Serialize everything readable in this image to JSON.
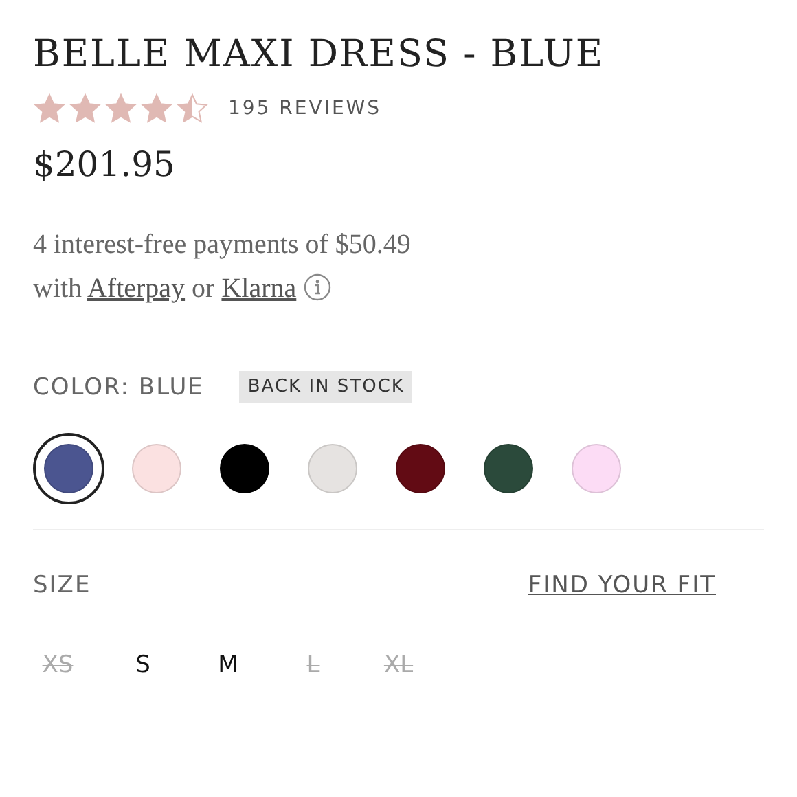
{
  "product": {
    "title": "BELLE MAXI DRESS - BLUE",
    "stars": 4.5,
    "reviews": "195 REVIEWS",
    "price": "$201.95"
  },
  "payment": {
    "lead": "4 interest-free payments of $50.49 with",
    "provider_1": "Afterpay",
    "separator": "or",
    "provider_2": "Klarna"
  },
  "color": {
    "label": "COLOR: BLUE",
    "badge": "BACK IN STOCK",
    "swatches": [
      {
        "color": "#4b5590",
        "selected": true
      },
      {
        "color": "#fbe1e1",
        "selected": false
      },
      {
        "color": "#000000",
        "selected": false
      },
      {
        "color": "#e6e3e1",
        "selected": false
      },
      {
        "color": "#620b14",
        "selected": false
      },
      {
        "color": "#2b4a3b",
        "selected": false
      },
      {
        "color": "#fcdcf5",
        "selected": false
      }
    ]
  },
  "size": {
    "label": "SIZE",
    "fit_link": "FIND YOUR FIT",
    "options": [
      {
        "label": "XS",
        "disabled": true
      },
      {
        "label": "S",
        "disabled": false
      },
      {
        "label": "M",
        "disabled": false
      },
      {
        "label": "L",
        "disabled": true
      },
      {
        "label": "XL",
        "disabled": true
      }
    ]
  }
}
